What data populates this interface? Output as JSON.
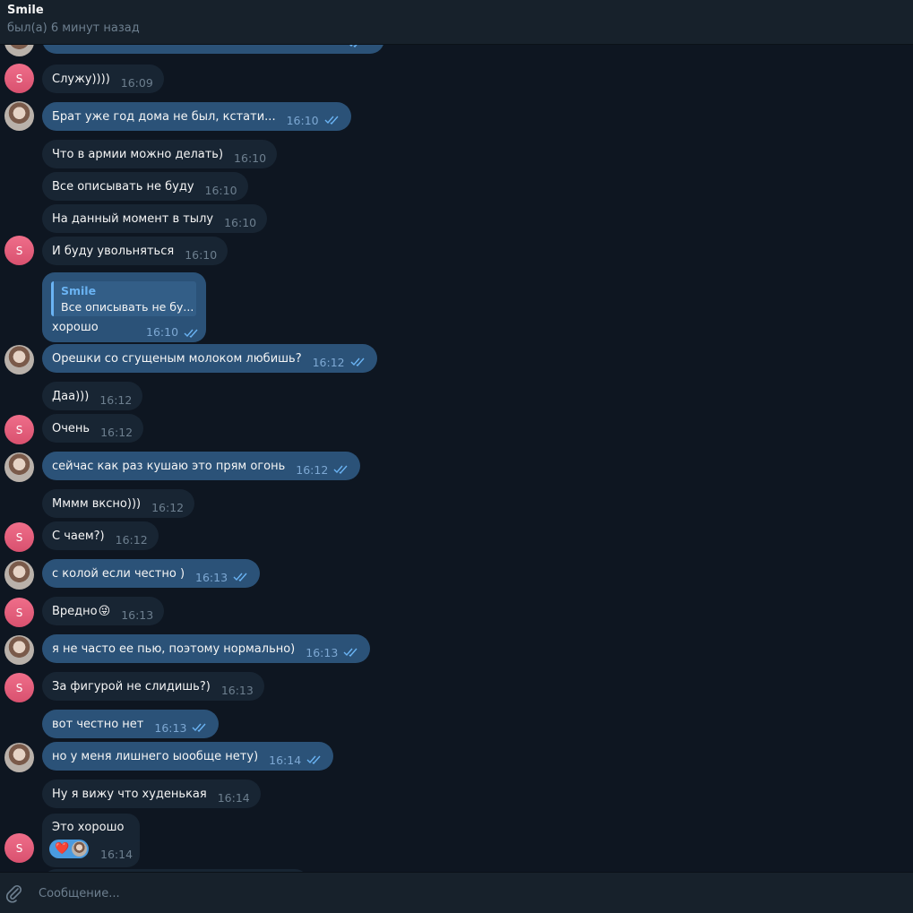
{
  "header": {
    "title": "Smile",
    "status": "был(а) 6 минут назад"
  },
  "avatars": {
    "contact_letter": "S"
  },
  "messages": [
    {
      "text": "Служу))))",
      "time": "16:09"
    },
    {
      "text": "Брат уже год дома не был, кстати...",
      "time": "16:10"
    },
    {
      "text": "Что в армии можно делать)",
      "time": "16:10"
    },
    {
      "text": "Все описывать не буду",
      "time": "16:10"
    },
    {
      "text": "На данный момент в тылу",
      "time": "16:10"
    },
    {
      "text": "И буду увольняться",
      "time": "16:10"
    },
    {
      "text": "Орешки со сгущеным молоком любишь?",
      "time": "16:12"
    },
    {
      "text": "Даа)))",
      "time": "16:12"
    },
    {
      "text": "Очень",
      "time": "16:12"
    },
    {
      "text": "сейчас как раз кушаю это прям огонь",
      "time": "16:12"
    },
    {
      "text": "Мммм вксно)))",
      "time": "16:12"
    },
    {
      "text": "С чаем?)",
      "time": "16:12"
    },
    {
      "text": "с колой если честно )",
      "time": "16:13"
    },
    {
      "text": "Вредно",
      "emoji": "😜",
      "time": "16:13"
    },
    {
      "text": "я не часто ее пью, поэтому нормально)",
      "time": "16:13"
    },
    {
      "text": "За фигурой не слидишь?)",
      "time": "16:13"
    },
    {
      "text": "вот честно нет",
      "time": "16:13"
    },
    {
      "text": "но у меня лишнего ыообще нету)",
      "time": "16:14"
    },
    {
      "text": "Ну я вижу что худенькая",
      "time": "16:14"
    }
  ],
  "reply_message": {
    "quote_name": "Smile",
    "quote_text": "Все описывать не бу...",
    "text": "хорошо",
    "time": "16:10"
  },
  "reaction_message": {
    "text": "Это хорошо",
    "reaction": "❤️",
    "time": "16:14"
  },
  "composer": {
    "placeholder": "Сообщение..."
  },
  "colors": {
    "background": "#0e1621",
    "incoming": "#182533",
    "outgoing": "#2b5278",
    "accent": "#6ab3f3"
  },
  "icons": {
    "attach": "paperclip-icon",
    "read": "double-check-icon"
  }
}
